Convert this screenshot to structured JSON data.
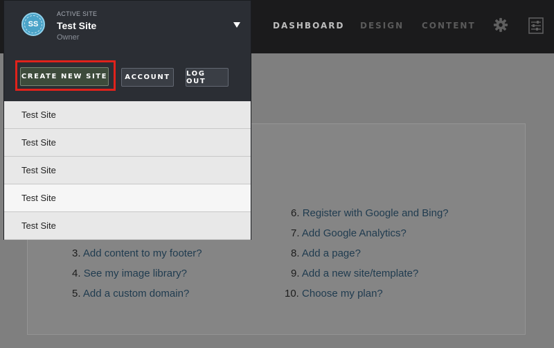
{
  "nav": {
    "dashboard": "DASHBOARD",
    "design": "DESIGN",
    "content": "CONTENT",
    "settings_icon": "gear-icon",
    "panel_icon": "sliders-icon"
  },
  "help_links": [
    {
      "num": "3.",
      "text": "Add content to my footer?"
    },
    {
      "num": "4.",
      "text": "See my image library?"
    },
    {
      "num": "5.",
      "text": "Add a custom domain?"
    },
    {
      "num": "6.",
      "text": "Register with Google and Bing?"
    },
    {
      "num": "7.",
      "text": "Add Google Analytics?"
    },
    {
      "num": "8.",
      "text": "Add a page?"
    },
    {
      "num": "9.",
      "text": "Add a new site/template?"
    },
    {
      "num": "10.",
      "text": "Choose my plan?"
    }
  ],
  "dropdown": {
    "avatar_initials": "SS",
    "active_label": "ACTIVE SITE",
    "site_name": "Test Site",
    "role": "Owner",
    "buttons": {
      "create": "CREATE NEW SITE",
      "account": "ACCOUNT",
      "logout": "LOG OUT"
    },
    "sites": [
      "Test Site",
      "Test Site",
      "Test Site",
      "Test Site",
      "Test Site"
    ]
  },
  "colors": {
    "highlight": "#e0221b",
    "topbar": "#1b1b1c",
    "dropdown_bg": "#2b2e34",
    "link": "#1f3b4f"
  }
}
